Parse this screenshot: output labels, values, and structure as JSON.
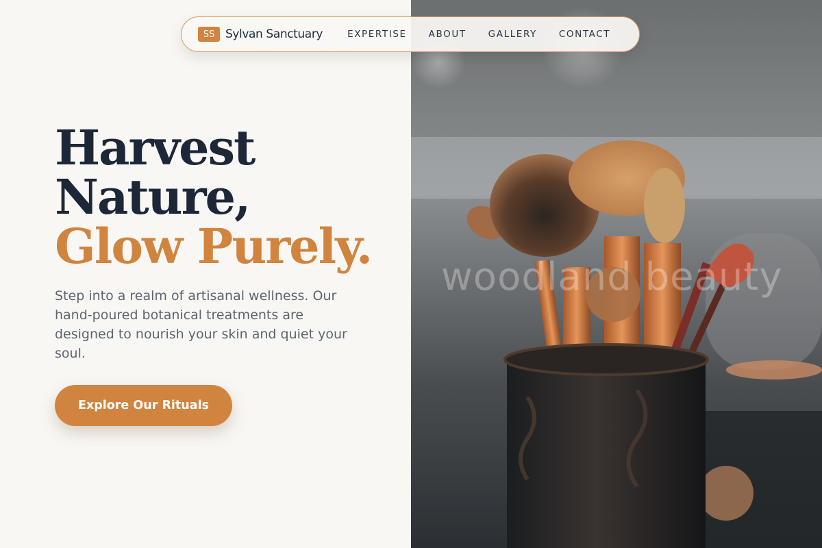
{
  "brand": {
    "mark": "SS",
    "name": "Sylvan Sanctuary"
  },
  "nav": {
    "links": [
      "EXPERTISE",
      "ABOUT",
      "GALLERY",
      "CONTACT"
    ]
  },
  "hero": {
    "headline_line1": "Harvest",
    "headline_line2": "Nature,",
    "headline_line3": "Glow Purely.",
    "lede": "Step into a realm of artisanal wellness. Our hand-poured botanical treatments are designed to nourish your skin and quiet your soul.",
    "cta_label": "Explore Our Rituals",
    "image_watermark": "woodland beauty",
    "image_subject": "makeup-brushes-in-holder"
  },
  "colors": {
    "accent": "#d1843f",
    "headline_dark": "#1c2738",
    "background": "#f9f7f3",
    "body_text": "#5d6470"
  }
}
